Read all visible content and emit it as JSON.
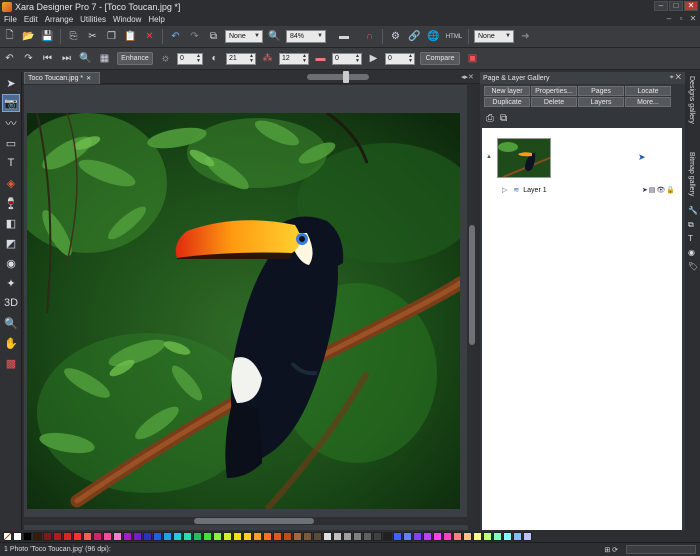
{
  "window": {
    "title": "Xara Designer Pro 7 - [Toco Toucan.jpg *]"
  },
  "menu": [
    {
      "label": "File"
    },
    {
      "label": "Edit"
    },
    {
      "label": "Arrange"
    },
    {
      "label": "Utilities"
    },
    {
      "label": "Window"
    },
    {
      "label": "Help"
    }
  ],
  "toolbar1": {
    "quality_combo": "None",
    "zoom_combo": "84%",
    "export_combo": "None",
    "html_label": "HTML"
  },
  "toolbar2": {
    "enhance_label": "Enhance",
    "brightness": "0",
    "contrast": "21",
    "saturation": "12",
    "temperature": "0",
    "sharpness": "0",
    "compare_label": "Compare"
  },
  "document_tab": {
    "label": "Toco Toucan.jpg *"
  },
  "gallery": {
    "title": "Page & Layer Gallery",
    "buttons": [
      "New layer",
      "Properties...",
      "Pages",
      "Locate",
      "Duplicate",
      "Delete",
      "Layers",
      "More..."
    ],
    "layer_name": "Layer 1"
  },
  "dock_tabs": [
    "Designs gallery",
    "Bitmap gallery"
  ],
  "status": {
    "text": "1 Photo 'Toco Toucan.jpg' (96 dpi):"
  },
  "palette": [
    "#ffffff",
    "#000000",
    "#3a1a0a",
    "#7a1a1a",
    "#b01c1c",
    "#e02424",
    "#ff3030",
    "#ff5a5a",
    "#d81f6a",
    "#ff4aa0",
    "#ff7ad0",
    "#a020c0",
    "#7020d0",
    "#3030c0",
    "#2060e0",
    "#20a0f0",
    "#20d0e0",
    "#20e0b0",
    "#20c060",
    "#40e040",
    "#90f040",
    "#d0f020",
    "#f0e020",
    "#ffd020",
    "#ffa020",
    "#ff7020",
    "#e05a10",
    "#c04a20",
    "#a06a40",
    "#7a5a3a",
    "#5a4a3a",
    "#e0e0e0",
    "#c0c0c0",
    "#a0a0a0",
    "#808080",
    "#606060",
    "#404040",
    "#202020",
    "#4060ff",
    "#6080ff",
    "#8040ff",
    "#c040ff",
    "#ff40ff",
    "#ff40c0",
    "#ff8080",
    "#ffc080",
    "#ffff80",
    "#c0ff80",
    "#80ffc0",
    "#80ffff",
    "#80c0ff",
    "#c0c0ff"
  ],
  "colors": {
    "accent": "#4a6a8f",
    "bg": "#2b2d30"
  }
}
